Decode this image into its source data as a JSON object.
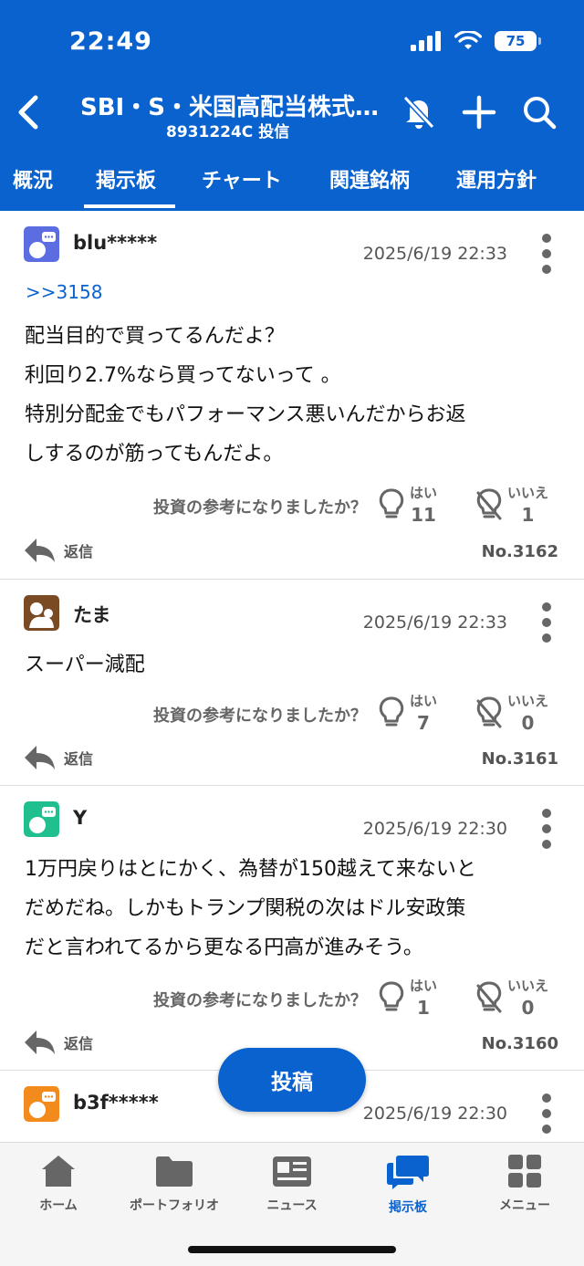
{
  "status_bar": {
    "time": "22:49",
    "battery": "75"
  },
  "nav": {
    "title": "SBI・S・米国高配当株式…",
    "subtitle": "8931224C 投信"
  },
  "tabs": [
    "概況",
    "掲示板",
    "チャート",
    "関連銘柄",
    "運用方針"
  ],
  "colors": {
    "brand": "#0a62cf"
  },
  "posts": [
    {
      "username": "blu*****",
      "avatar_color": "#5b6de0",
      "timestamp": "2025/6/19 22:33",
      "reply_to": ">>3158",
      "body": "配当目的で買ってるんだよ？\n利回り2.7%なら買ってないって 。\n特別分配金でもパフォーマンス悪いんだからお返\nしするのが筋ってもんだよ。",
      "vote_question": "投資の参考になりましたか？",
      "yes_label": "はい",
      "yes_count": "11",
      "no_label": "いいえ",
      "no_count": "1",
      "reply_label": "返信",
      "number": "No.3162"
    },
    {
      "username": "たま",
      "avatar_color": "#7a4a23",
      "timestamp": "2025/6/19 22:33",
      "body": "スーパー減配",
      "vote_question": "投資の参考になりましたか？",
      "yes_label": "はい",
      "yes_count": "7",
      "no_label": "いいえ",
      "no_count": "0",
      "reply_label": "返信",
      "number": "No.3161"
    },
    {
      "username": "Y",
      "avatar_color": "#1fbf8f",
      "timestamp": "2025/6/19 22:30",
      "body": "1万円戻りはとにかく、為替が150越えて来ないと\nだめだね。しかもトランプ関税の次はドル安政策\nだと言われてるから更なる円高が進みそう。",
      "vote_question": "投資の参考になりましたか？",
      "yes_label": "はい",
      "yes_count": "1",
      "no_label": "いいえ",
      "no_count": "0",
      "reply_label": "返信",
      "number": "No.3160"
    },
    {
      "username": "b3f*****",
      "avatar_color": "#f28a1c",
      "timestamp": "2025/6/19 22:30"
    }
  ],
  "fab_label": "投稿",
  "bottom_nav": [
    {
      "label": "ホーム",
      "icon": "home-icon"
    },
    {
      "label": "ポートフォリオ",
      "icon": "folder-icon"
    },
    {
      "label": "ニュース",
      "icon": "news-icon"
    },
    {
      "label": "掲示板",
      "icon": "chat-icon"
    },
    {
      "label": "メニュー",
      "icon": "grid-icon"
    }
  ]
}
